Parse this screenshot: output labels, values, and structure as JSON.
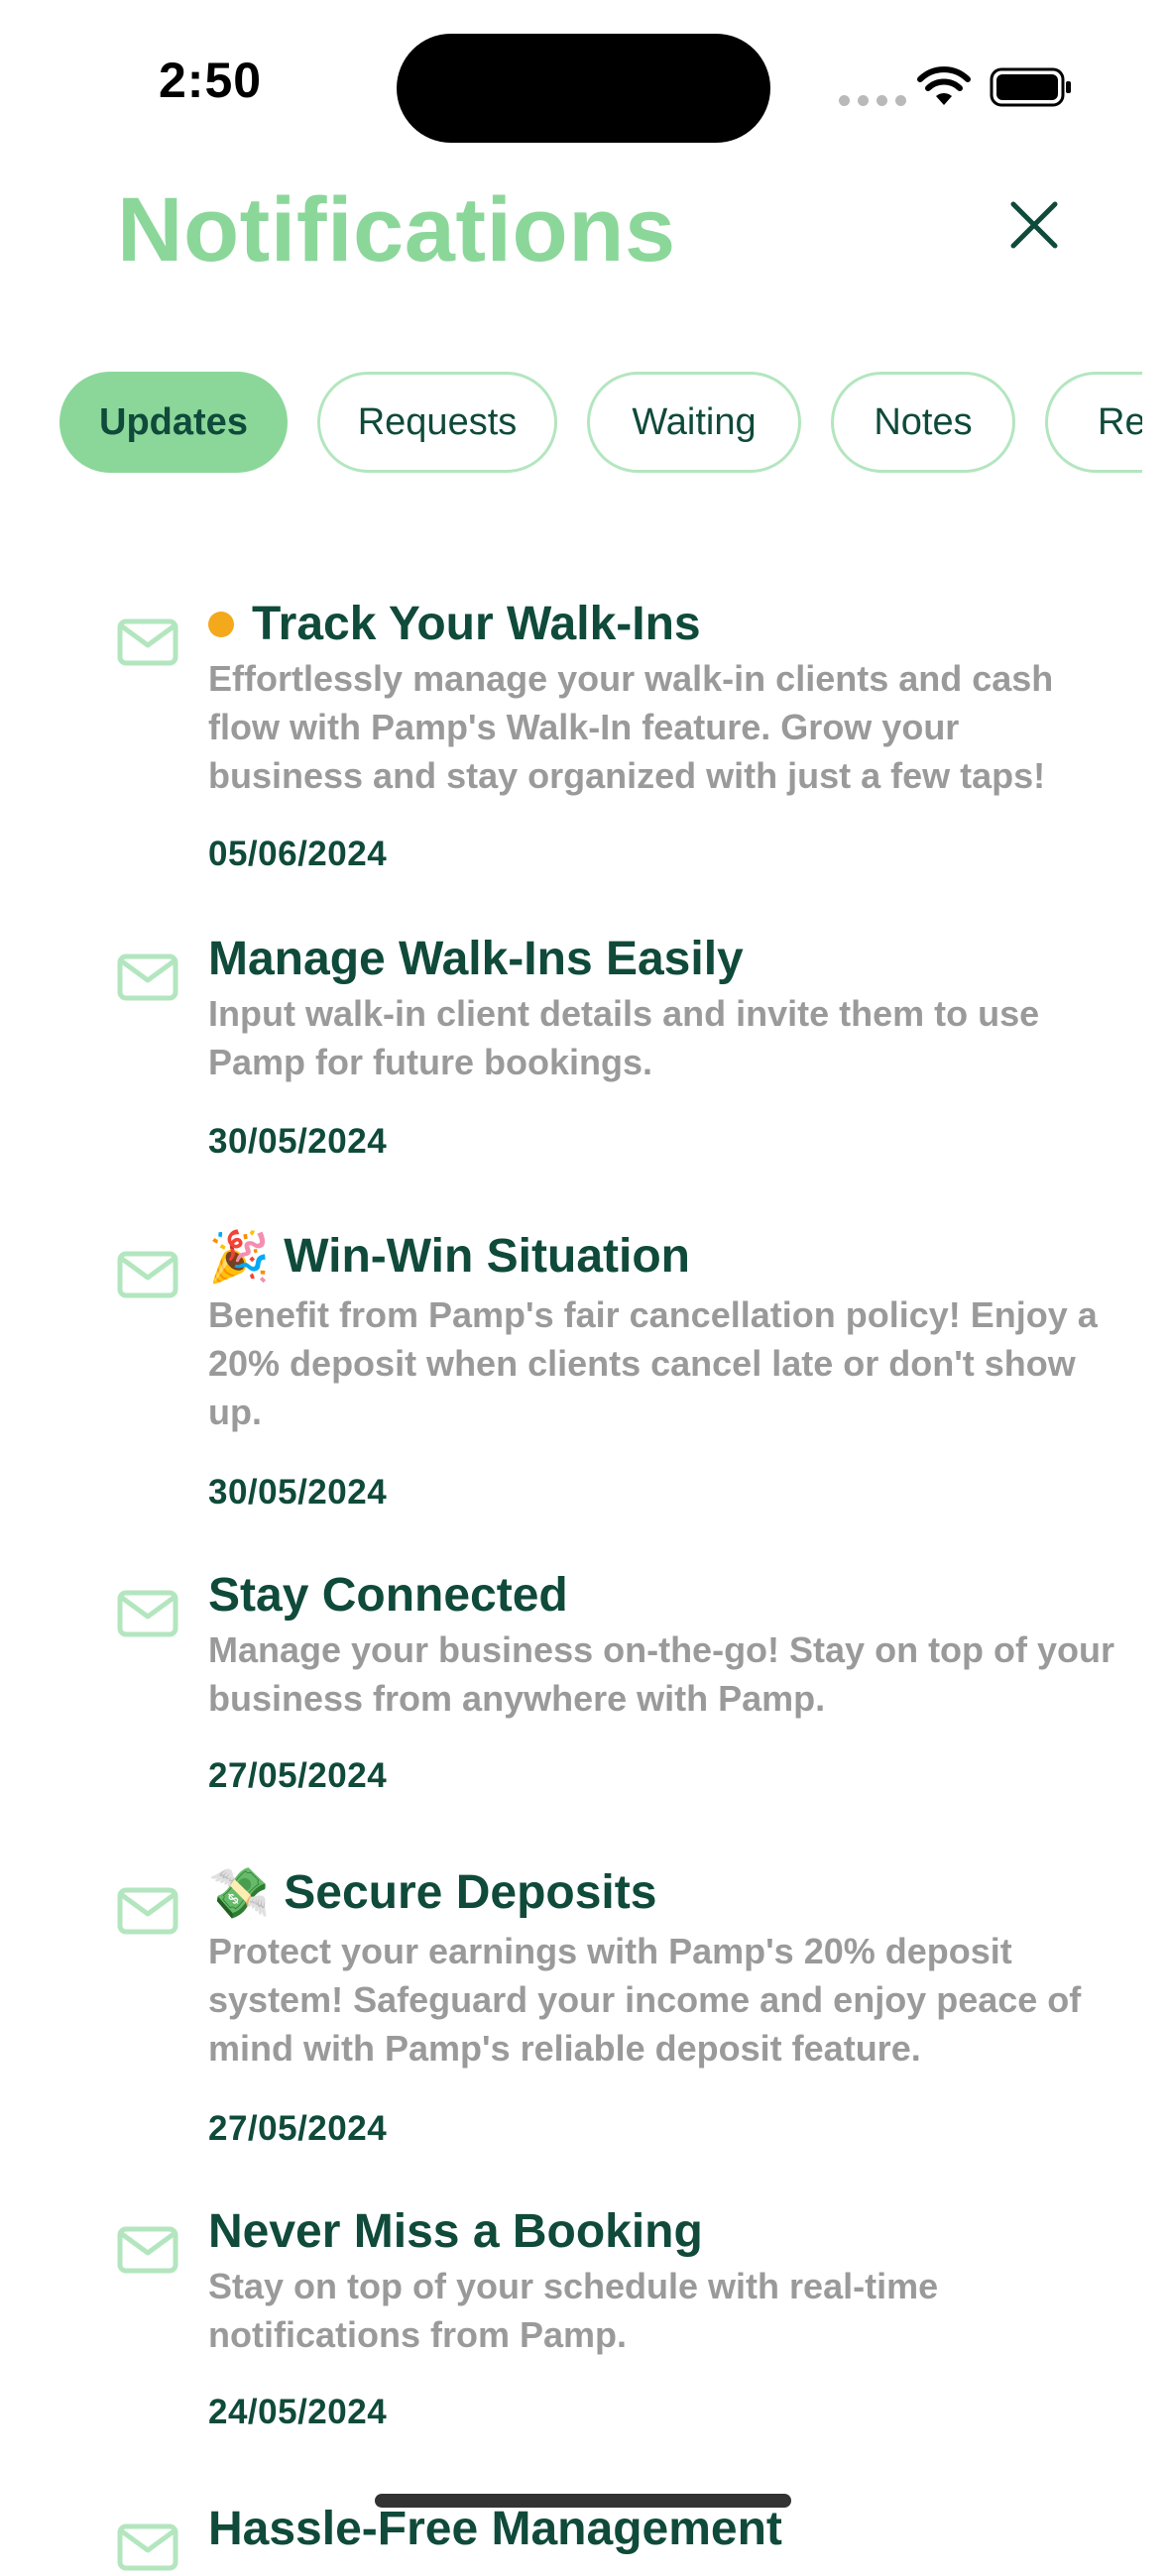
{
  "status_bar": {
    "time": "2:50"
  },
  "header": {
    "title": "Notifications",
    "close_icon": "close-icon"
  },
  "colors": {
    "accent": "#8bd79a",
    "tab_border": "#b3e6bf",
    "dark_green": "#0f4a3a",
    "body_gray": "#9a9a9a",
    "unread_dot": "#f4a81b"
  },
  "tabs": [
    {
      "label": "Updates",
      "active": true
    },
    {
      "label": "Requests",
      "active": false
    },
    {
      "label": "Waiting",
      "active": false
    },
    {
      "label": "Notes",
      "active": false
    },
    {
      "label": "Re",
      "active": false
    }
  ],
  "notifications": [
    {
      "title": "Track Your Walk-Ins",
      "unread": true,
      "emoji": "",
      "body": "Effortlessly manage your walk-in clients and cash flow with Pamp's Walk-In feature. Grow your business and stay organized with just a few taps!",
      "date": "05/06/2024"
    },
    {
      "title": "Manage Walk-Ins Easily",
      "unread": false,
      "emoji": "",
      "body": "Input walk-in client details and invite them to use Pamp for future bookings.",
      "date": "30/05/2024"
    },
    {
      "title": "Win-Win Situation",
      "unread": false,
      "emoji": "🎉",
      "body": "Benefit from Pamp's fair cancellation policy! Enjoy a 20% deposit when clients cancel late or don't show up.",
      "date": "30/05/2024"
    },
    {
      "title": "Stay Connected",
      "unread": false,
      "emoji": "",
      "body": "Manage your business on-the-go! Stay on top of your business from anywhere with Pamp.",
      "date": "27/05/2024"
    },
    {
      "title": "Secure Deposits",
      "unread": false,
      "emoji": "💸",
      "body": "Protect your earnings with Pamp's 20% deposit system! Safeguard your income and enjoy peace of mind with Pamp's reliable deposit feature.",
      "date": "27/05/2024"
    },
    {
      "title": "Never Miss a Booking",
      "unread": false,
      "emoji": "",
      "body": "Stay on top of your schedule with real-time notifications from Pamp.",
      "date": "24/05/2024"
    },
    {
      "title": "Hassle-Free Management",
      "unread": false,
      "emoji": "",
      "body": "",
      "date": ""
    }
  ]
}
